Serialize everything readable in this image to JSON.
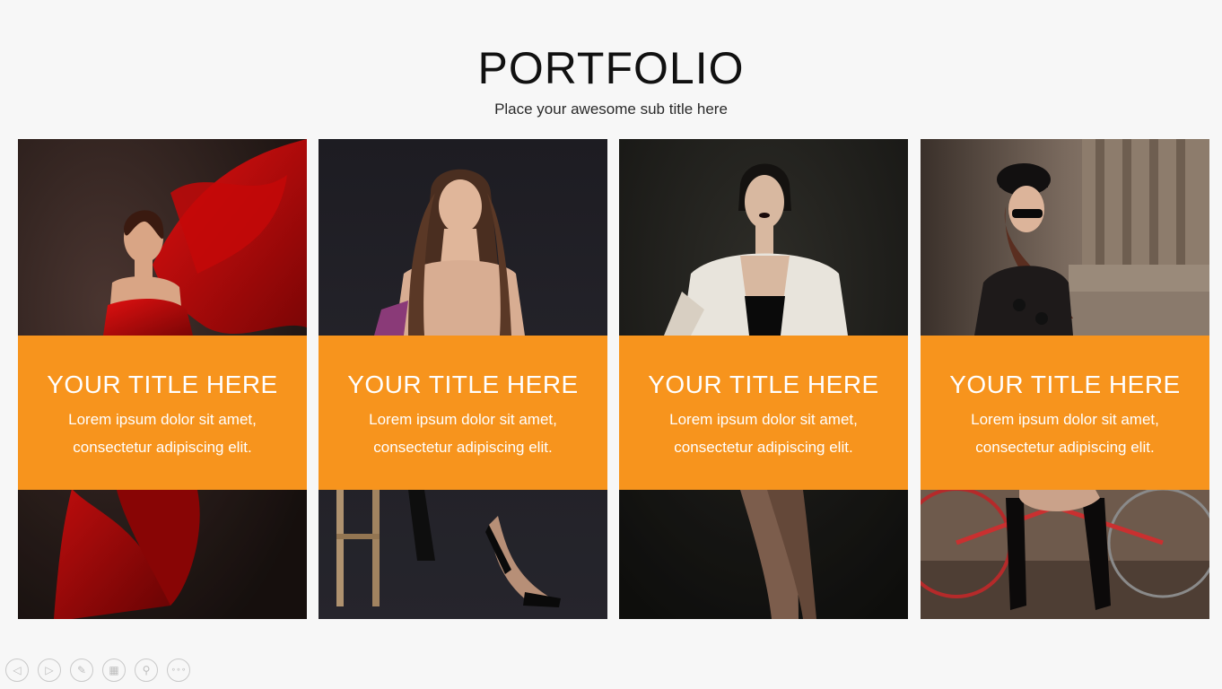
{
  "header": {
    "title": "PORTFOLIO",
    "subtitle": "Place your awesome sub title here"
  },
  "accent_color": "#f7941d",
  "cards": [
    {
      "title": "YOUR TITLE HERE",
      "line1": "Lorem ipsum dolor sit amet,",
      "line2": "consectetur adipiscing elit.",
      "photo": "woman-red-dress-photo"
    },
    {
      "title": "YOUR TITLE HERE",
      "line1": "Lorem ipsum dolor sit amet,",
      "line2": "consectetur adipiscing elit.",
      "photo": "woman-long-hair-stool-photo"
    },
    {
      "title": "YOUR TITLE HERE",
      "line1": "Lorem ipsum dolor sit amet,",
      "line2": "consectetur adipiscing elit.",
      "photo": "woman-white-blazer-photo"
    },
    {
      "title": "YOUR TITLE HERE",
      "line1": "Lorem ipsum dolor sit amet,",
      "line2": "consectetur adipiscing elit.",
      "photo": "woman-hat-bicycle-photo"
    }
  ],
  "controls": [
    {
      "name": "previous-icon",
      "glyph": "◁"
    },
    {
      "name": "next-icon",
      "glyph": "▷"
    },
    {
      "name": "pen-icon",
      "glyph": "✎"
    },
    {
      "name": "slides-grid-icon",
      "glyph": "▦"
    },
    {
      "name": "zoom-icon",
      "glyph": "⚲"
    },
    {
      "name": "more-options-icon",
      "glyph": "∘∘∘"
    }
  ]
}
